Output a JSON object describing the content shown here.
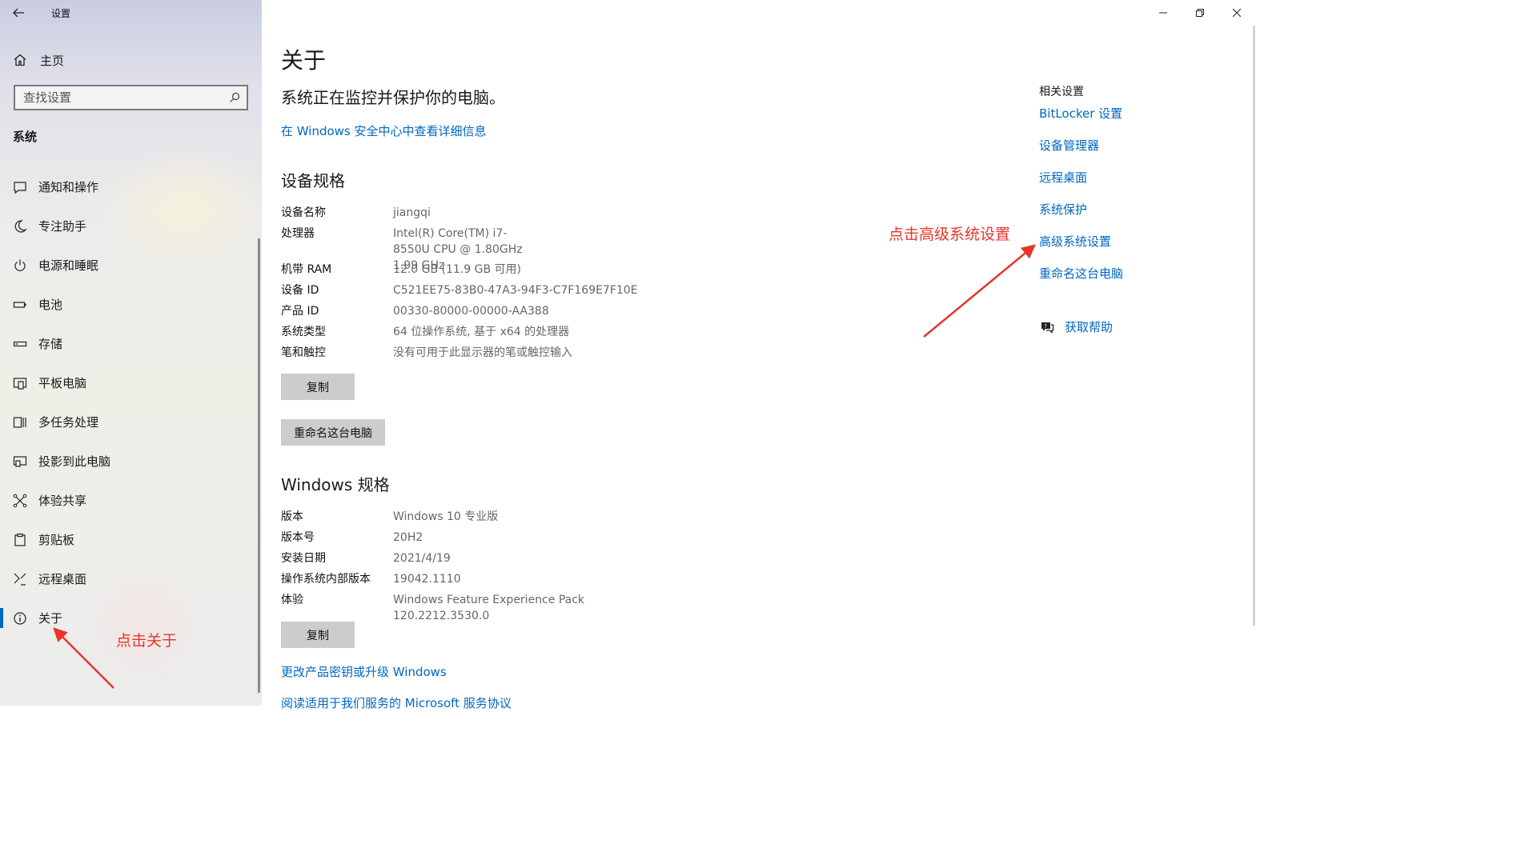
{
  "window": {
    "title": "设置"
  },
  "sidebar": {
    "home_label": "主页",
    "search_placeholder": "查找设置",
    "section_title": "系统",
    "items": [
      {
        "label": "通知和操作",
        "icon": "notification-icon"
      },
      {
        "label": "专注助手",
        "icon": "moon-icon"
      },
      {
        "label": "电源和睡眠",
        "icon": "power-icon"
      },
      {
        "label": "电池",
        "icon": "battery-icon"
      },
      {
        "label": "存储",
        "icon": "storage-icon"
      },
      {
        "label": "平板电脑",
        "icon": "tablet-icon"
      },
      {
        "label": "多任务处理",
        "icon": "multitask-icon"
      },
      {
        "label": "投影到此电脑",
        "icon": "project-icon"
      },
      {
        "label": "体验共享",
        "icon": "share-icon"
      },
      {
        "label": "剪贴板",
        "icon": "clipboard-icon"
      },
      {
        "label": "远程桌面",
        "icon": "remote-icon"
      },
      {
        "label": "关于",
        "icon": "info-icon",
        "active": true
      }
    ]
  },
  "main": {
    "page_title": "关于",
    "protection_status": "系统正在监控并保护你的电脑。",
    "security_link": "在 Windows 安全中心中查看详细信息",
    "device_spec": {
      "heading": "设备规格",
      "rows": [
        {
          "key": "设备名称",
          "value": "jiangqi"
        },
        {
          "key": "处理器",
          "value": "Intel(R) Core(TM) i7-8550U CPU @ 1.80GHz   1.99 GHz"
        },
        {
          "key": "机带 RAM",
          "value": "12.0 GB (11.9 GB 可用)"
        },
        {
          "key": "设备 ID",
          "value": "C521EE75-83B0-47A3-94F3-C7F169E7F10E"
        },
        {
          "key": "产品 ID",
          "value": "00330-80000-00000-AA388"
        },
        {
          "key": "系统类型",
          "value": "64 位操作系统, 基于 x64 的处理器"
        },
        {
          "key": "笔和触控",
          "value": "没有可用于此显示器的笔或触控输入"
        }
      ],
      "copy_label": "复制",
      "rename_label": "重命名这台电脑"
    },
    "windows_spec": {
      "heading": "Windows 规格",
      "rows": [
        {
          "key": "版本",
          "value": "Windows 10 专业版"
        },
        {
          "key": "版本号",
          "value": "20H2"
        },
        {
          "key": "安装日期",
          "value": "2021/4/19"
        },
        {
          "key": "操作系统内部版本",
          "value": "19042.1110"
        },
        {
          "key": "体验",
          "value": "Windows Feature Experience Pack 120.2212.3530.0"
        }
      ],
      "copy_label": "复制"
    },
    "links": {
      "change_key": "更改产品密钥或升级 Windows",
      "msa": "阅读适用于我们服务的 Microsoft 服务协议"
    }
  },
  "related": {
    "heading": "相关设置",
    "links": [
      "BitLocker 设置",
      "设备管理器",
      "远程桌面",
      "系统保护",
      "高级系统设置",
      "重命名这台电脑"
    ],
    "help_label": "获取帮助"
  },
  "annotations": {
    "click_about": "点击关于",
    "click_advanced": "点击高级系统设置"
  },
  "colors": {
    "accent": "#0067c0",
    "annotation": "#e8342a"
  }
}
